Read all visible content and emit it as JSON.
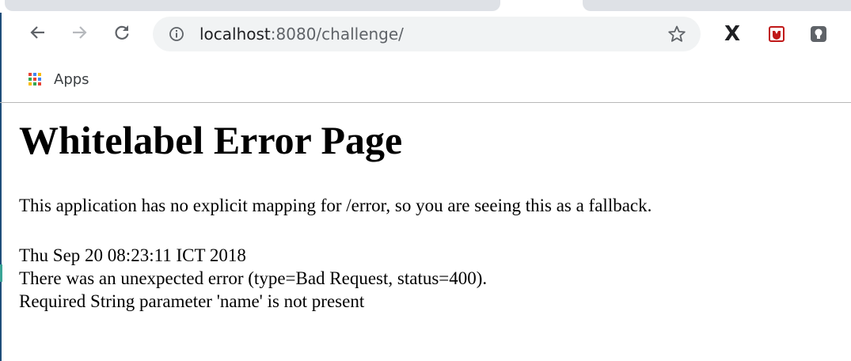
{
  "browser": {
    "url_host": "localhost",
    "url_rest": ":8080/challenge/",
    "bookmarks": [
      {
        "label": "Apps"
      }
    ]
  },
  "colors": {
    "apps_grid": [
      "#ea4335",
      "#4285f4",
      "#fbbc05",
      "#34a853",
      "#ea4335",
      "#4285f4",
      "#fbbc05",
      "#34a853",
      "#ea4335"
    ],
    "mcafee_red": "#c01818"
  },
  "page": {
    "title": "Whitelabel Error Page",
    "message": "This application has no explicit mapping for /error, so you are seeing this as a fallback.",
    "timestamp": "Thu Sep 20 08:23:11 ICT 2018",
    "error_line": "There was an unexpected error (type=Bad Request, status=400).",
    "detail_line": "Required String parameter 'name' is not present"
  }
}
